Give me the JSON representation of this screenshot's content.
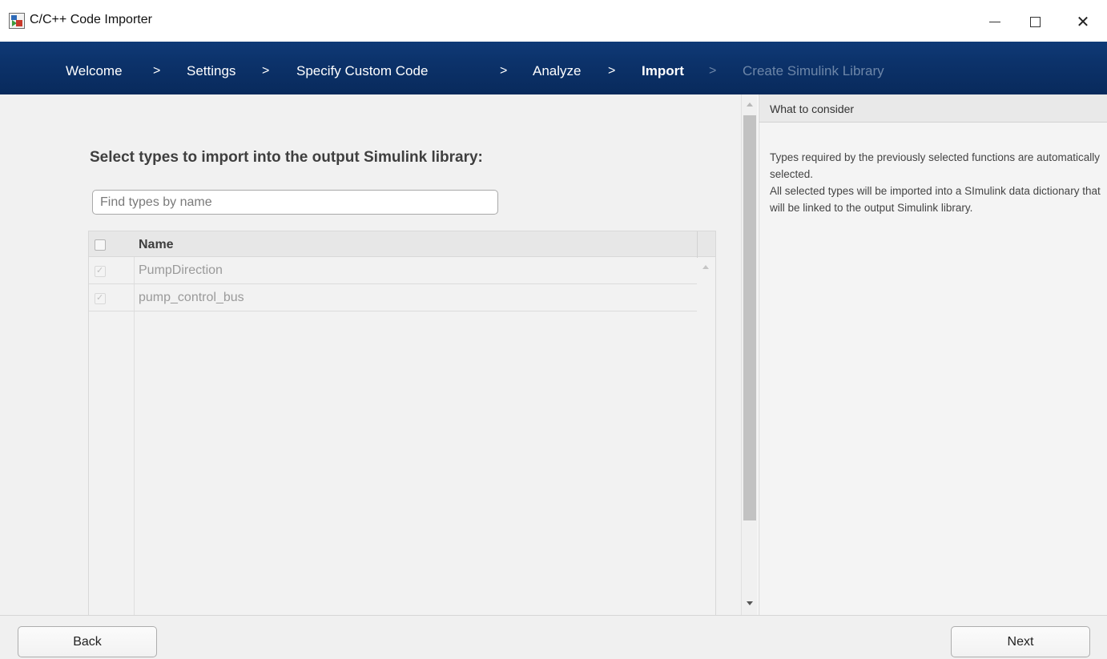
{
  "window": {
    "title": "C/C++ Code Importer",
    "controls": {
      "minimize": "—",
      "maximize": "☐",
      "close": "✕"
    }
  },
  "breadcrumb": {
    "steps": [
      {
        "label": "Welcome",
        "state": "done"
      },
      {
        "label": "Settings",
        "state": "done"
      },
      {
        "label": "Specify Custom Code",
        "state": "done"
      },
      {
        "label": "Analyze",
        "state": "done"
      },
      {
        "label": "Import",
        "state": "current"
      },
      {
        "label": "Create Simulink Library",
        "state": "pending"
      }
    ],
    "separator": ">"
  },
  "main": {
    "heading": "Select types to import into the output Simulink library:",
    "search_placeholder": "Find types by name",
    "table": {
      "column_name": "Name",
      "header_checked": false,
      "rows": [
        {
          "name": "PumpDirection",
          "checked": true
        },
        {
          "name": "pump_control_bus",
          "checked": true
        }
      ]
    }
  },
  "side_panel": {
    "title": "What to consider",
    "paragraphs": [
      "Types required by the previously selected functions are automatically selected.",
      "All selected types will be imported into a SImulink data dictionary that will be linked to the output Simulink library."
    ]
  },
  "footer": {
    "back_label": "Back",
    "next_label": "Next"
  },
  "colors": {
    "crumb_bar": "#0c326a",
    "crumb_text": "#ffffff",
    "crumb_dim": "#6d86a8"
  }
}
